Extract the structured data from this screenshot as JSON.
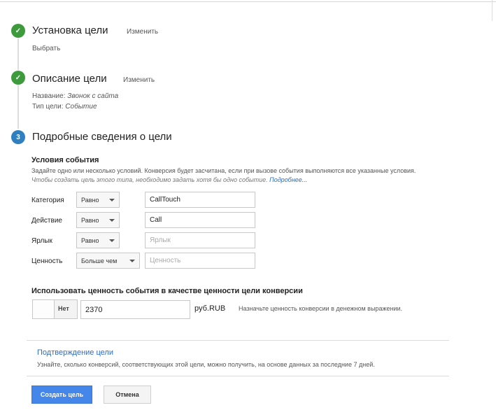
{
  "steps": [
    {
      "num": "✓",
      "title": "Установка цели",
      "edit": "Изменить",
      "detail": "Выбрать"
    },
    {
      "num": "✓",
      "title": "Описание цели",
      "edit": "Изменить",
      "name_label": "Название:",
      "name_value": "Звонок с сайта",
      "type_label": "Тип цели:",
      "type_value": "Событие"
    },
    {
      "num": "3",
      "title": "Подробные сведения о цели"
    }
  ],
  "conditions": {
    "heading": "Условия события",
    "hint": "Задайте одно или несколько условий. Конверсия будет засчитана, если при вызове события выполняются все указанные условия.",
    "hint2": "Чтобы создать цель этого типа, необходимо задать хотя бы одно событие.",
    "more_link": "Подробнее...",
    "rows": [
      {
        "label": "Категория",
        "operator": "Равно",
        "value": "CallTouch",
        "placeholder": ""
      },
      {
        "label": "Действие",
        "operator": "Равно",
        "value": "Call",
        "placeholder": ""
      },
      {
        "label": "Ярлык",
        "operator": "Равно",
        "value": "",
        "placeholder": "Ярлык"
      },
      {
        "label": "Ценность",
        "operator": "Больше чем",
        "value": "",
        "placeholder": "Ценность"
      }
    ]
  },
  "use_value": {
    "title": "Использовать ценность события в качестве ценности цели конверсии",
    "toggle_label": "Нет",
    "value": "2370",
    "currency": "руб.RUB",
    "hint": "Назначьте ценность конверсии в денежном выражении."
  },
  "verify": {
    "link": "Подтверждение цели",
    "hint": "Узнайте, сколько конверсий, соответствующих этой цели, можно получить, на основе данных за последние 7 дней."
  },
  "buttons": {
    "create": "Создать цель",
    "cancel": "Отмена"
  },
  "colors": {
    "done": "#3d9a3d",
    "active": "#2f7fc1",
    "primary": "#4486ea",
    "link": "#2a6cc7"
  }
}
